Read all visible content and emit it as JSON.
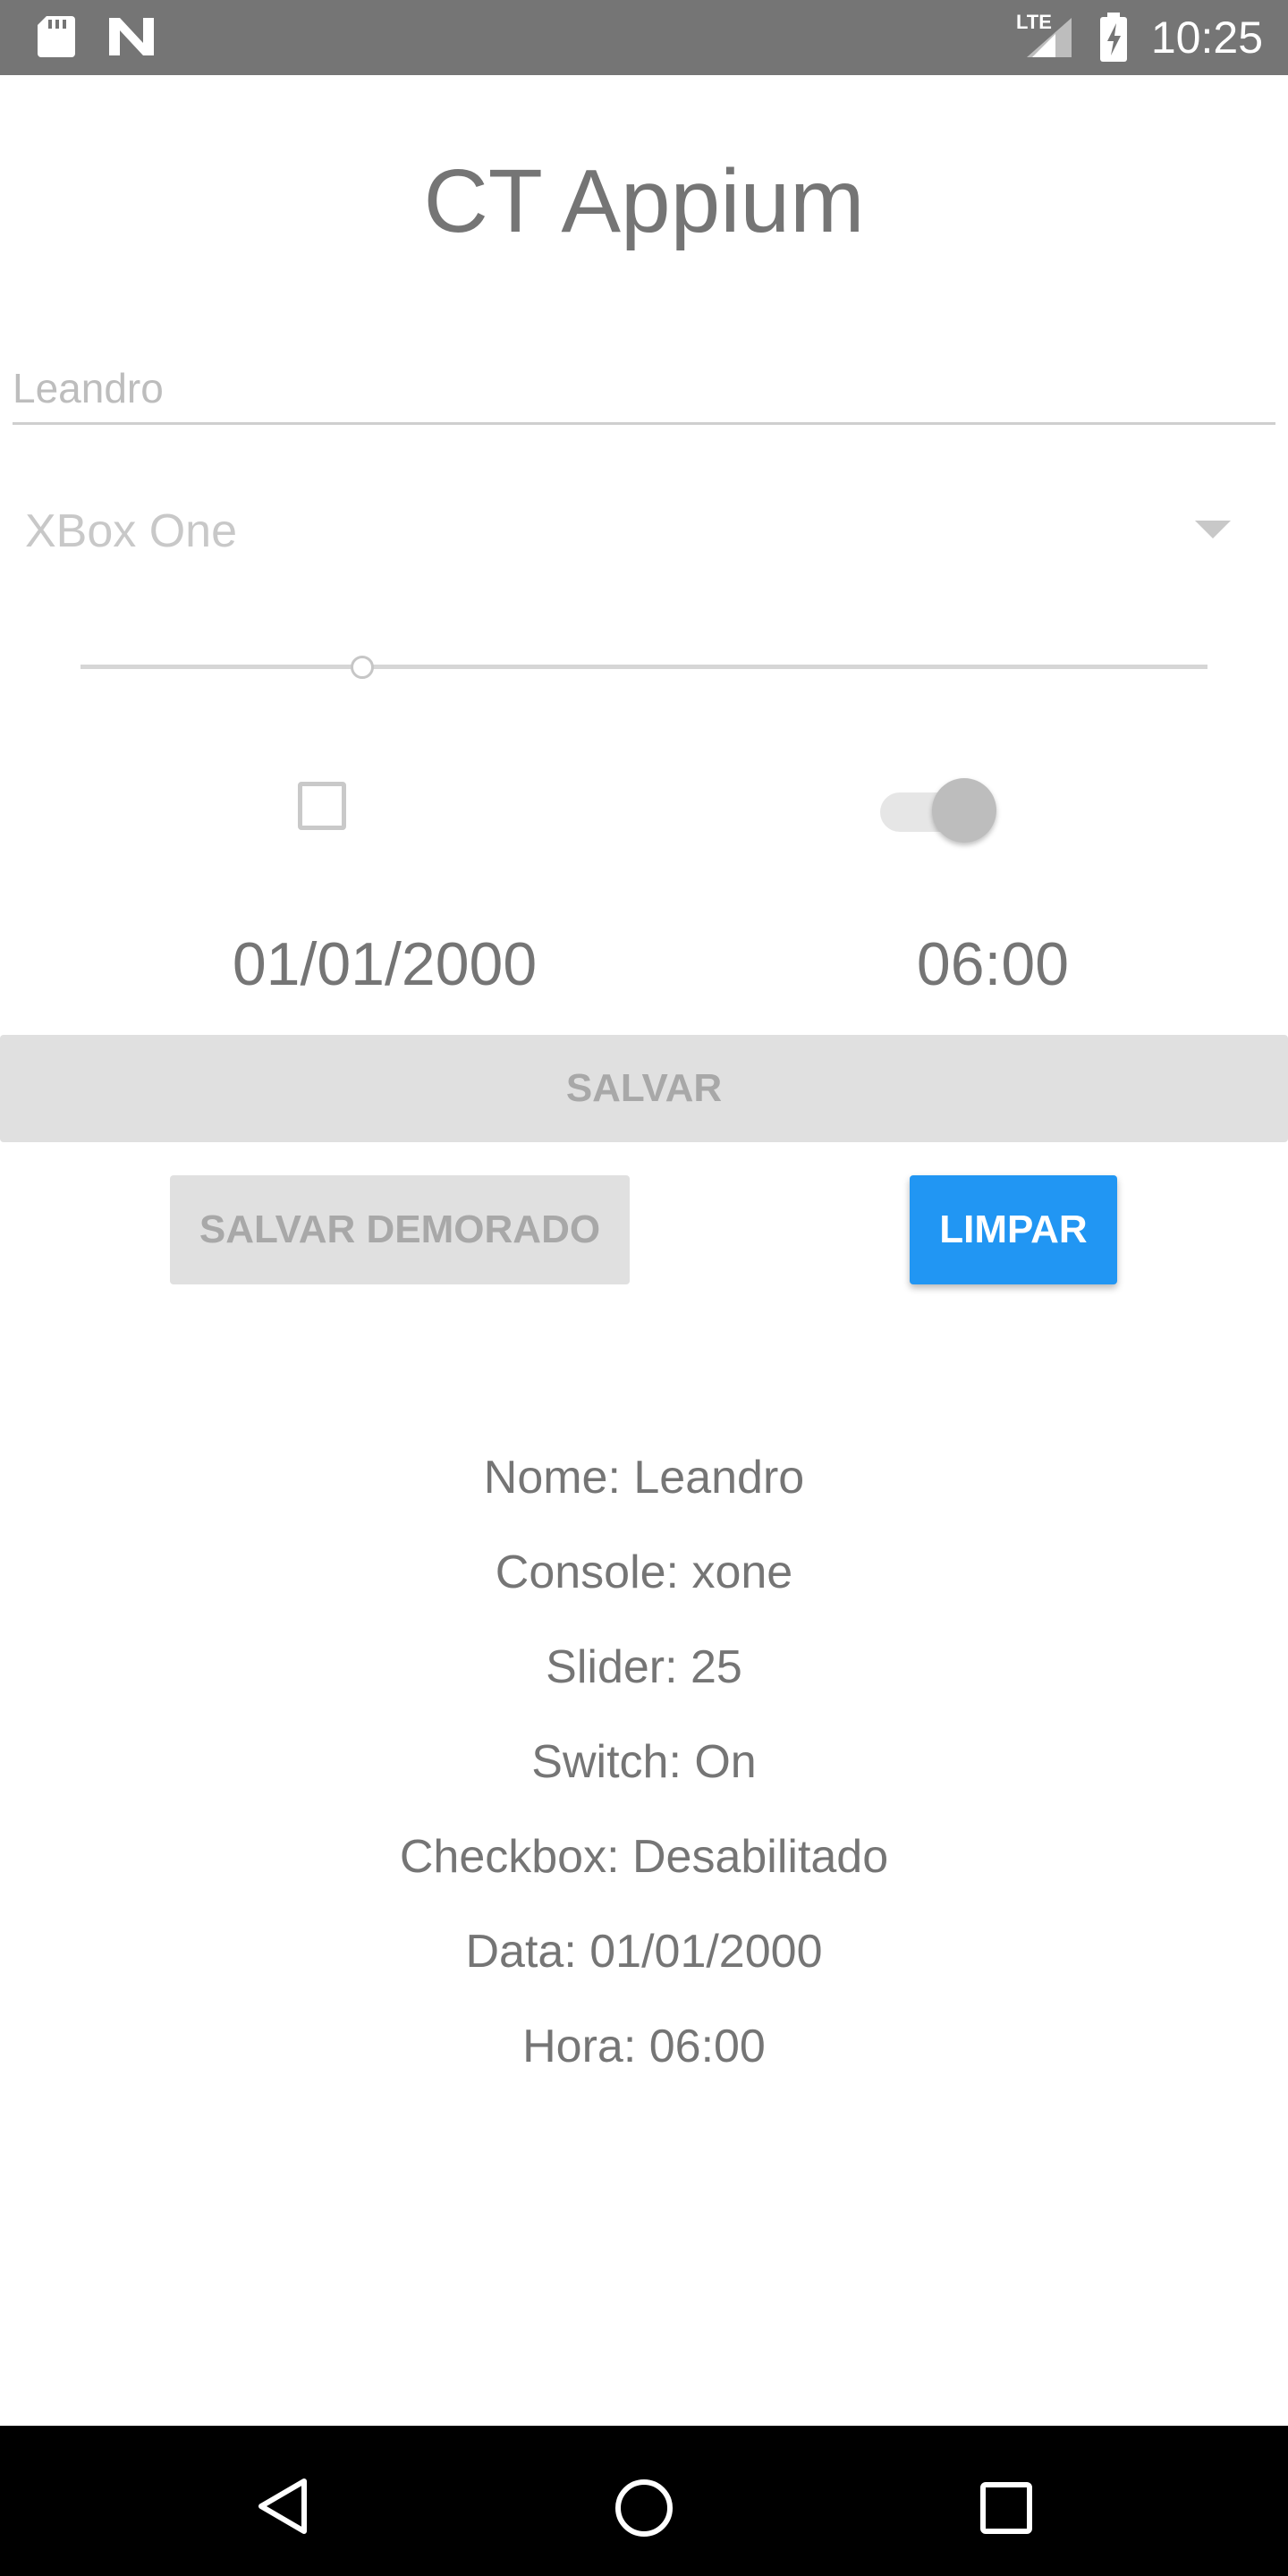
{
  "status_bar": {
    "time": "10:25",
    "network_label": "LTE",
    "icons": [
      "sd-card-icon",
      "notification-n-icon",
      "lte-signal-icon",
      "battery-charging-icon"
    ]
  },
  "app": {
    "title": "CT Appium"
  },
  "form": {
    "name_value": "Leandro",
    "console_selected": "XBox One",
    "slider_level_percent": 25,
    "checkbox_checked": false,
    "switch_on": true,
    "date": "01/01/2000",
    "time": "06:00"
  },
  "buttons": {
    "save": "SALVAR",
    "save_delayed": "SALVAR DEMORADO",
    "clear": "LIMPAR"
  },
  "results": [
    "Nome: Leandro",
    "Console: xone",
    "Slider: 25",
    "Switch: On",
    "Checkbox: Desabilitado",
    "Data: 01/01/2000",
    "Hora: 06:00"
  ],
  "colors": {
    "status_bar": "#757575",
    "accent": "#2196f3",
    "text_gray": "#757575",
    "disabled_button": "#e0e0e0",
    "nav_bar": "#000000"
  },
  "nav": {
    "icons": [
      "back-icon",
      "home-icon",
      "recents-icon"
    ]
  }
}
